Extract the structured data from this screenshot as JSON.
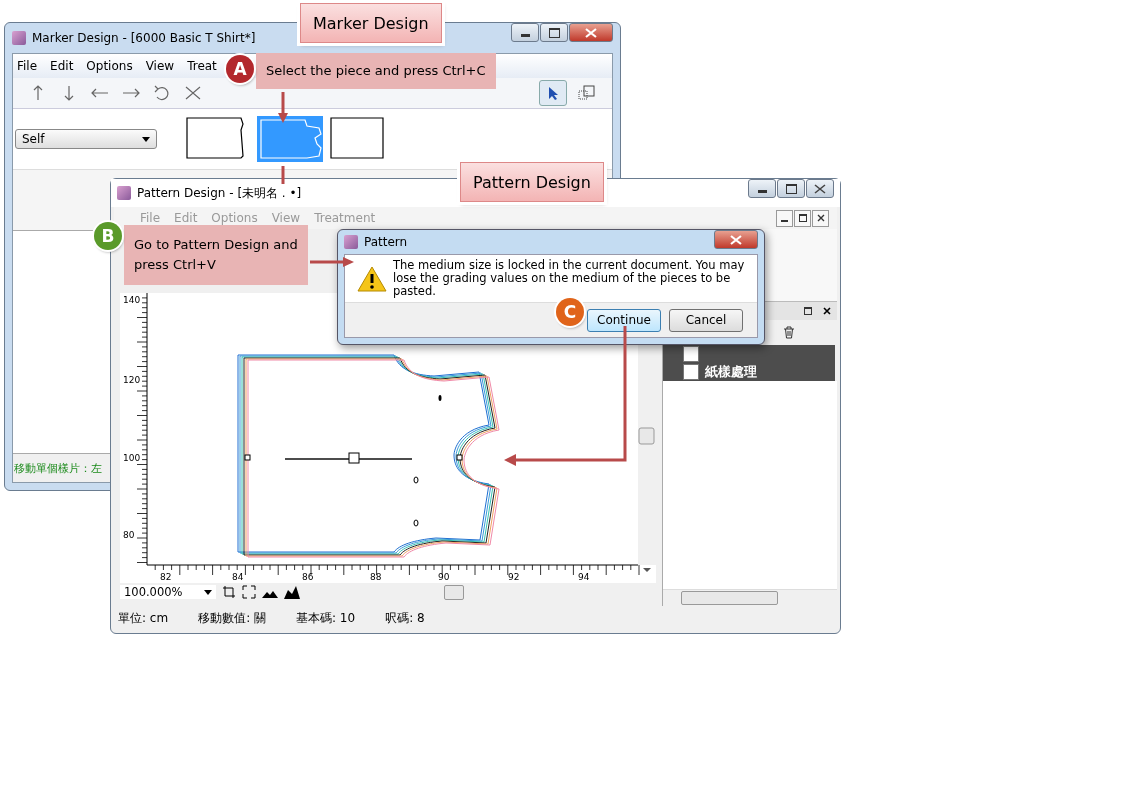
{
  "marker_window": {
    "title": "Marker Design - [6000 Basic T Shirt*]",
    "menu": [
      "File",
      "Edit",
      "Options",
      "View",
      "Treat"
    ],
    "dropdown": "Self",
    "pieces": [
      {
        "selected": false
      },
      {
        "selected": true
      },
      {
        "selected": false
      }
    ],
    "status": "移動單個樣片：左"
  },
  "pattern_window": {
    "title": "Pattern Design - [未明名 . •]",
    "menu": [
      "File",
      "Edit",
      "Options",
      "View",
      "Treatment"
    ],
    "y_ruler": [
      "140",
      "120",
      "100",
      "80"
    ],
    "x_ruler": [
      "82",
      "84",
      "86",
      "88",
      "90",
      "92",
      "94"
    ],
    "zoom": "100.000%",
    "layers": [
      {
        "checked": false
      },
      {
        "label": "紙樣處理",
        "checked": false
      }
    ],
    "status": [
      "單位: cm",
      "移動數值: 關",
      "基本碼: 10",
      "呎碼: 8"
    ]
  },
  "dialog": {
    "title": "Pattern",
    "message": "The medium size is locked in the current document. You may lose the grading values on the medium of the pieces to be pasted.",
    "buttons": [
      {
        "label": "Continue",
        "default": true
      },
      {
        "label": "Cancel",
        "default": false
      }
    ]
  },
  "callouts": [
    {
      "label": "Marker Design"
    },
    {
      "label": "Pattern Design"
    }
  ],
  "steps": [
    {
      "letter": "A",
      "text": "Select the piece and press Ctrl+C",
      "color": "#b3282d"
    },
    {
      "letter": "B",
      "text": "Go to Pattern Design and press Ctrl+V",
      "color": "#5a9a2a"
    },
    {
      "letter": "C",
      "color": "#e0641a"
    }
  ]
}
